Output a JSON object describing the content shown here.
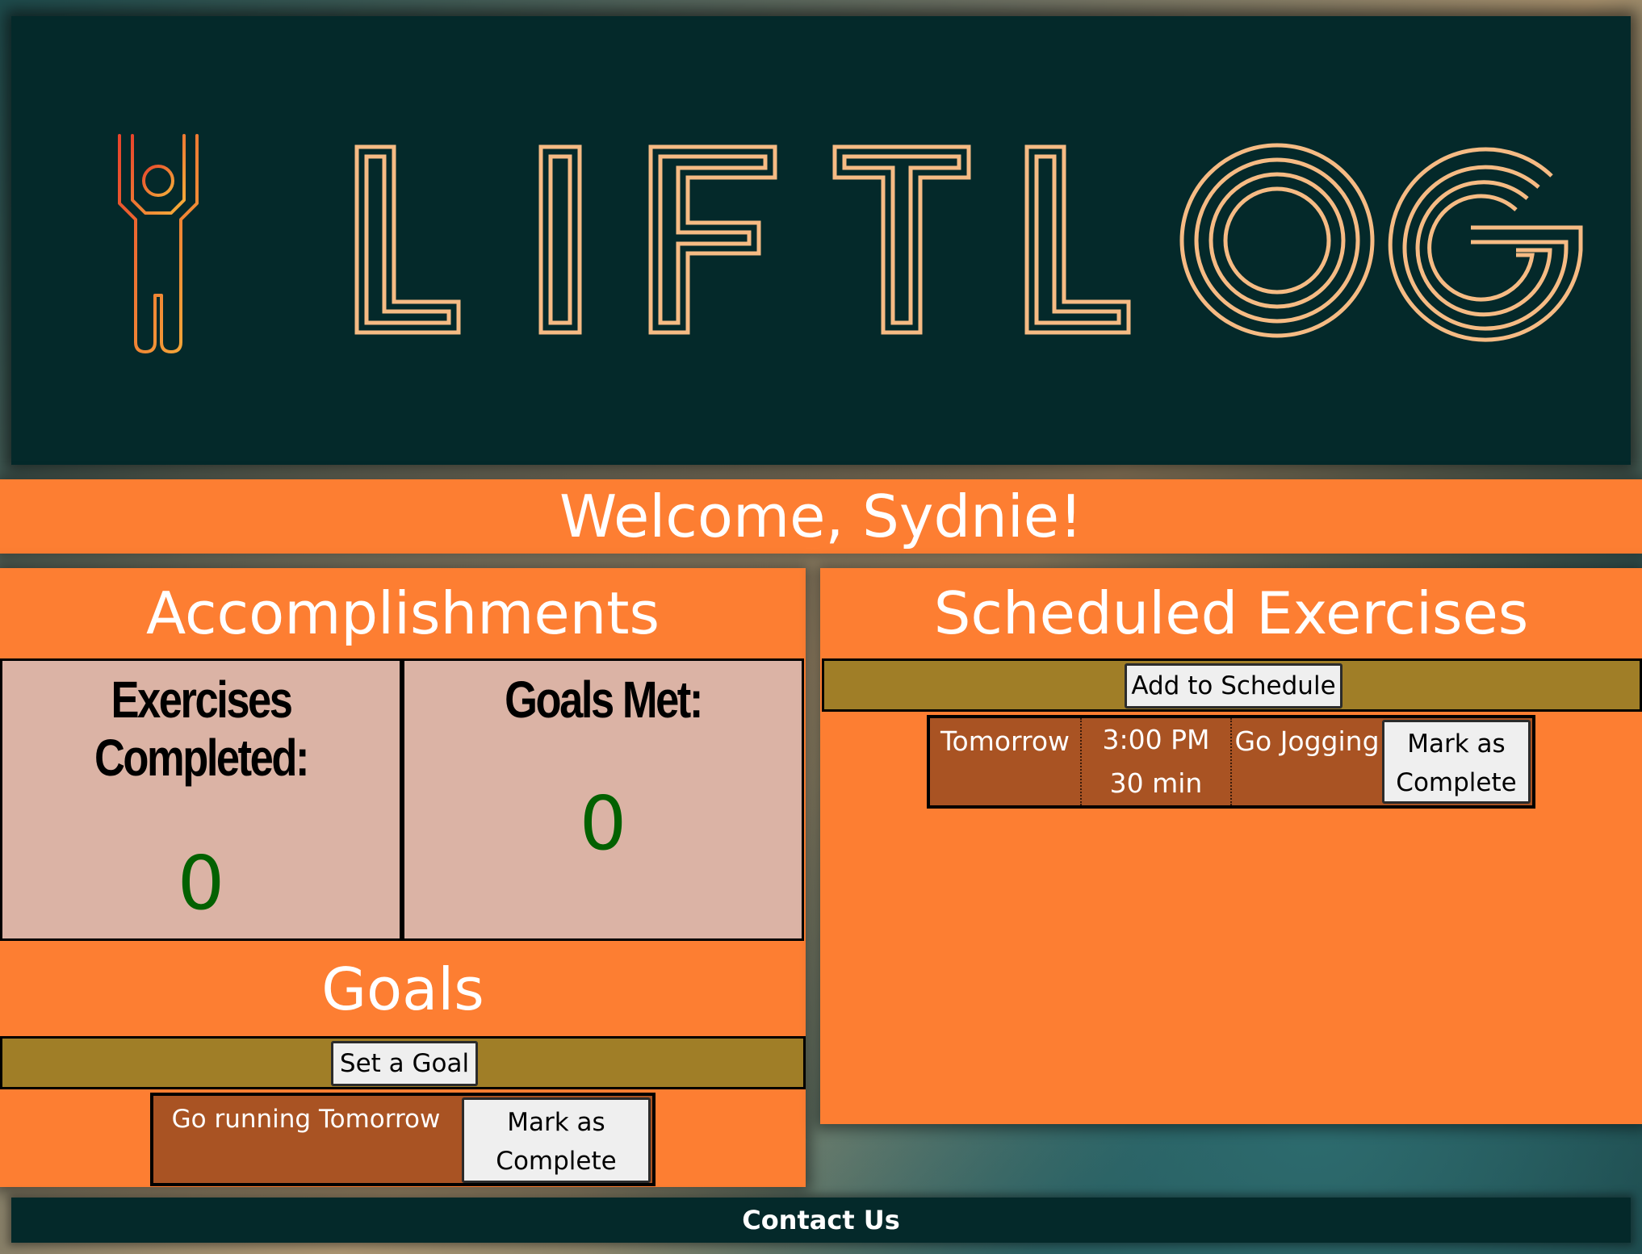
{
  "brand": {
    "name": "LIFTLOG",
    "colors": {
      "header_bg": "#04292a",
      "logo_text": "#f6bb84",
      "accent": "#fd7e32",
      "bar": "#a07e27",
      "row": "#a95323",
      "stat_value": "#026101"
    }
  },
  "welcome": {
    "text": "Welcome, Sydnie!"
  },
  "accomplishments": {
    "title": "Accomplishments",
    "exercises_label_line1": "Exercises",
    "exercises_label_line2": "Completed:",
    "exercises_value": "0",
    "goals_label": "Goals Met:",
    "goals_value": "0"
  },
  "goals": {
    "title": "Goals",
    "set_goal_label": "Set a Goal",
    "items": [
      {
        "text": "Go running Tomorrow",
        "action_line1": "Mark as",
        "action_line2": "Complete"
      }
    ]
  },
  "schedule": {
    "title": "Scheduled Exercises",
    "add_label": "Add to Schedule",
    "items": [
      {
        "day": "Tomorrow",
        "time": "3:00 PM",
        "duration": "30 min",
        "activity": "Go Jogging",
        "action_line1": "Mark as",
        "action_line2": "Complete"
      }
    ]
  },
  "footer": {
    "contact_label": "Contact Us"
  },
  "icons": {
    "logo": "weightlifter-icon"
  }
}
